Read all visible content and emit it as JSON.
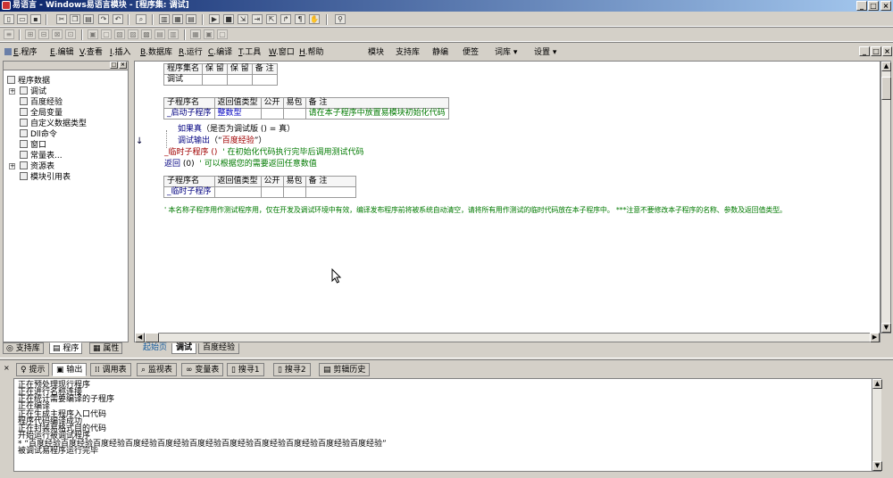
{
  "window": {
    "title": "易语言 - Windows易语言模块 - [程序集: 调试]"
  },
  "menu": [
    {
      "key": "E",
      "label": ".程序"
    },
    {
      "key": "E",
      "label": ".编辑"
    },
    {
      "key": "V",
      "label": ".查看"
    },
    {
      "key": "I",
      "label": ".插入"
    },
    {
      "key": "B",
      "label": ".数据库"
    },
    {
      "key": "R",
      "label": ".运行"
    },
    {
      "key": "C",
      "label": ".编译"
    },
    {
      "key": "T",
      "label": ".工具"
    },
    {
      "key": "W",
      "label": ".窗口"
    },
    {
      "key": "H",
      "label": ".帮助"
    }
  ],
  "menu_right": [
    "模块",
    "支持库",
    "静编",
    "便签",
    "词库 ▾",
    "设置 ▾"
  ],
  "tree": {
    "root": "程序数据",
    "items": [
      "调试",
      "百度经验",
      "全局变量",
      "自定义数据类型",
      "Dll命令",
      "窗口",
      "常量表...",
      "资源表",
      "模块引用表"
    ]
  },
  "left_tabs": [
    "支持库",
    "程序",
    "属性"
  ],
  "editor": {
    "assembly_table": {
      "headers": [
        "程序集名",
        "保 留",
        "保 留",
        "备 注"
      ],
      "row": [
        "调试",
        "",
        "",
        ""
      ]
    },
    "sub_table": {
      "headers": [
        "子程序名",
        "返回值类型",
        "公开",
        "易包",
        "备 注"
      ],
      "row": [
        "_启动子程序",
        "整数型",
        "",
        "",
        "请在本子程序中放置易模块初始化代码"
      ]
    },
    "code": {
      "if_keyword": "如果真",
      "if_cond": "（是否为调试版 () = 真）",
      "debug_call": "调试输出",
      "debug_arg_open": "（“",
      "debug_arg": "百度经验",
      "debug_arg_close": "”）",
      "temp_call": "_临时子程序 ()",
      "temp_comment": "' 在初始化代码执行完毕后调用测试代码",
      "return_kw": "返回",
      "return_arg": "(0)",
      "return_comment": "' 可以根据您的需要返回任意数值"
    },
    "sub_table2": {
      "headers": [
        "子程序名",
        "返回值类型",
        "公开",
        "易包",
        "备 注"
      ],
      "row": [
        "_临时子程序",
        "",
        "",
        "",
        ""
      ]
    },
    "note": "' 本名称子程序用作测试程序用，仅在开发及调试环境中有效，编译发布程序前将被系统自动清空，请将所有用作测试的临时代码放在本子程序中。 ***注意不要修改本子程序的名称、参数及返回值类型。"
  },
  "editor_tabs": [
    "起始页",
    "调试",
    "百度经验"
  ],
  "bottom_tabs": [
    "提示",
    "输出",
    "调用表",
    "监视表",
    "变量表",
    "搜寻1",
    "搜寻2",
    "剪辑历史"
  ],
  "output_lines": [
    "正在预处理现行程序",
    "正在进行名称连接",
    "正在统计需要编译的子程序",
    "正在编译",
    "正在生成主程序入口代码",
    "程序代码编译成功",
    "正在封装易格式目的代码",
    "开始运行被调试程序",
    "* “百度经验百度经验百度经验百度经验百度经验百度经验百度经验百度经验百度经验百度经验百度经验”",
    "被调试易程序运行完毕"
  ]
}
